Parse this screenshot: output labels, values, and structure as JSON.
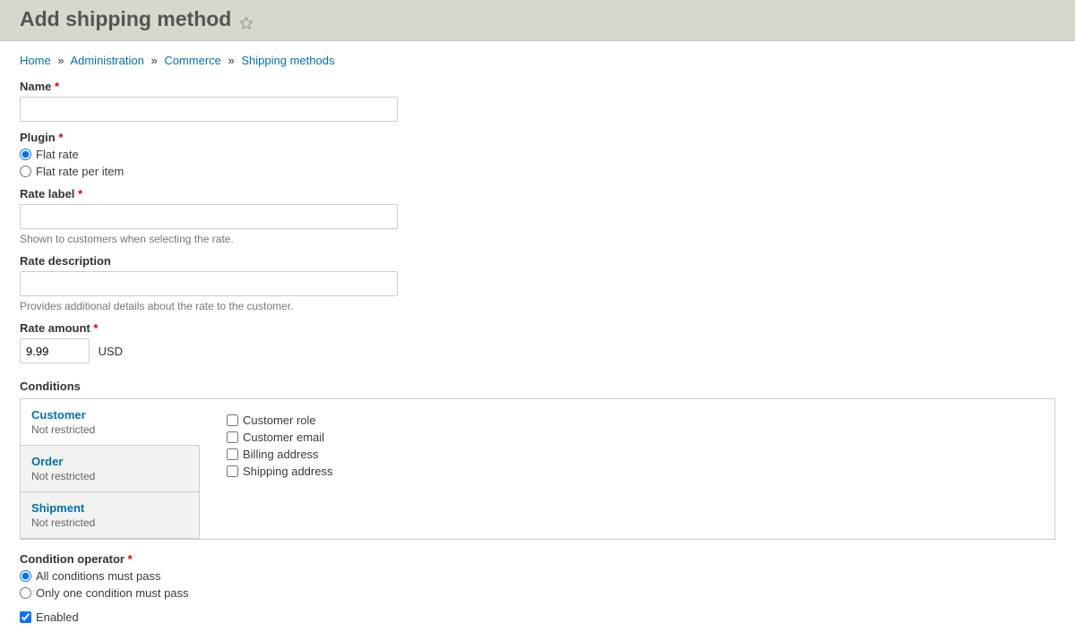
{
  "header": {
    "title": "Add shipping method"
  },
  "breadcrumb": {
    "items": [
      "Home",
      "Administration",
      "Commerce",
      "Shipping methods"
    ],
    "separator": "»"
  },
  "form": {
    "name": {
      "label": "Name",
      "value": ""
    },
    "plugin": {
      "label": "Plugin",
      "options": [
        "Flat rate",
        "Flat rate per item"
      ],
      "selected": "Flat rate"
    },
    "rate_label": {
      "label": "Rate label",
      "value": "",
      "description": "Shown to customers when selecting the rate."
    },
    "rate_description": {
      "label": "Rate description",
      "value": "",
      "description": "Provides additional details about the rate to the customer."
    },
    "rate_amount": {
      "label": "Rate amount",
      "value": "9.99",
      "currency": "USD"
    },
    "conditions": {
      "label": "Conditions",
      "tabs": [
        {
          "title": "Customer",
          "summary": "Not restricted"
        },
        {
          "title": "Order",
          "summary": "Not restricted"
        },
        {
          "title": "Shipment",
          "summary": "Not restricted"
        }
      ],
      "customer_conditions": [
        "Customer role",
        "Customer email",
        "Billing address",
        "Shipping address"
      ]
    },
    "condition_operator": {
      "label": "Condition operator",
      "options": [
        "All conditions must pass",
        "Only one condition must pass"
      ],
      "selected": "All conditions must pass"
    },
    "enabled": {
      "label": "Enabled",
      "checked": true
    }
  }
}
